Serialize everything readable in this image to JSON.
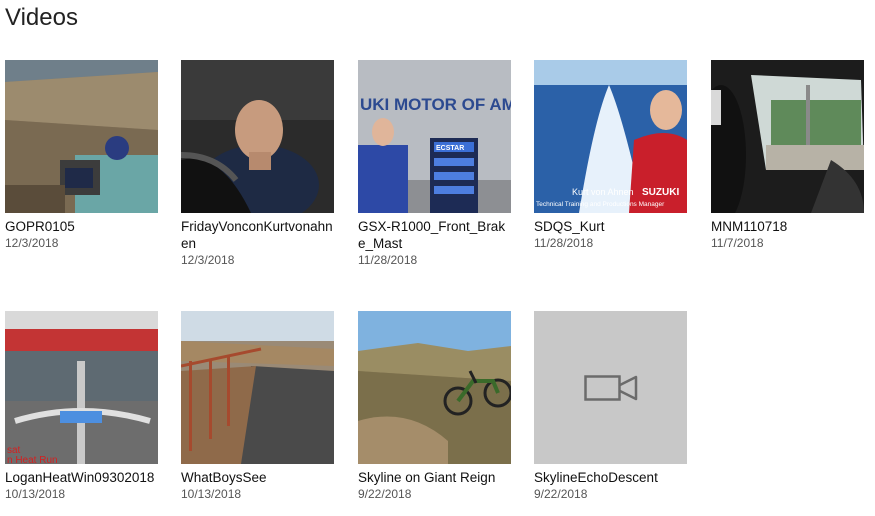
{
  "header": {
    "title": "Videos"
  },
  "videos": [
    {
      "name": "GOPR0105",
      "date": "12/3/2018"
    },
    {
      "name": "FridayVonconKurtvonahnen",
      "date": "12/3/2018"
    },
    {
      "name": "GSX-R1000_Front_Brake_Mast",
      "date": "11/28/2018",
      "overlay": "UKI MOTOR OF AM",
      "sign": "ECSTAR"
    },
    {
      "name": "SDQS_Kurt",
      "date": "11/28/2018",
      "caption1": "Kurt von Ahnen",
      "caption2": "Technical Training and Productions Manager",
      "brand": "SUZUKI"
    },
    {
      "name": "MNM110718",
      "date": "11/7/2018"
    },
    {
      "name": "LoganHeatWin09302018",
      "date": "10/13/2018",
      "overlay1": "sat",
      "overlay2": "n Heat Run"
    },
    {
      "name": "WhatBoysSee",
      "date": "10/13/2018"
    },
    {
      "name": "Skyline on Giant Reign",
      "date": "9/22/2018"
    },
    {
      "name": "SkylineEchoDescent",
      "date": "9/22/2018",
      "icon": "video-camera-icon"
    }
  ]
}
